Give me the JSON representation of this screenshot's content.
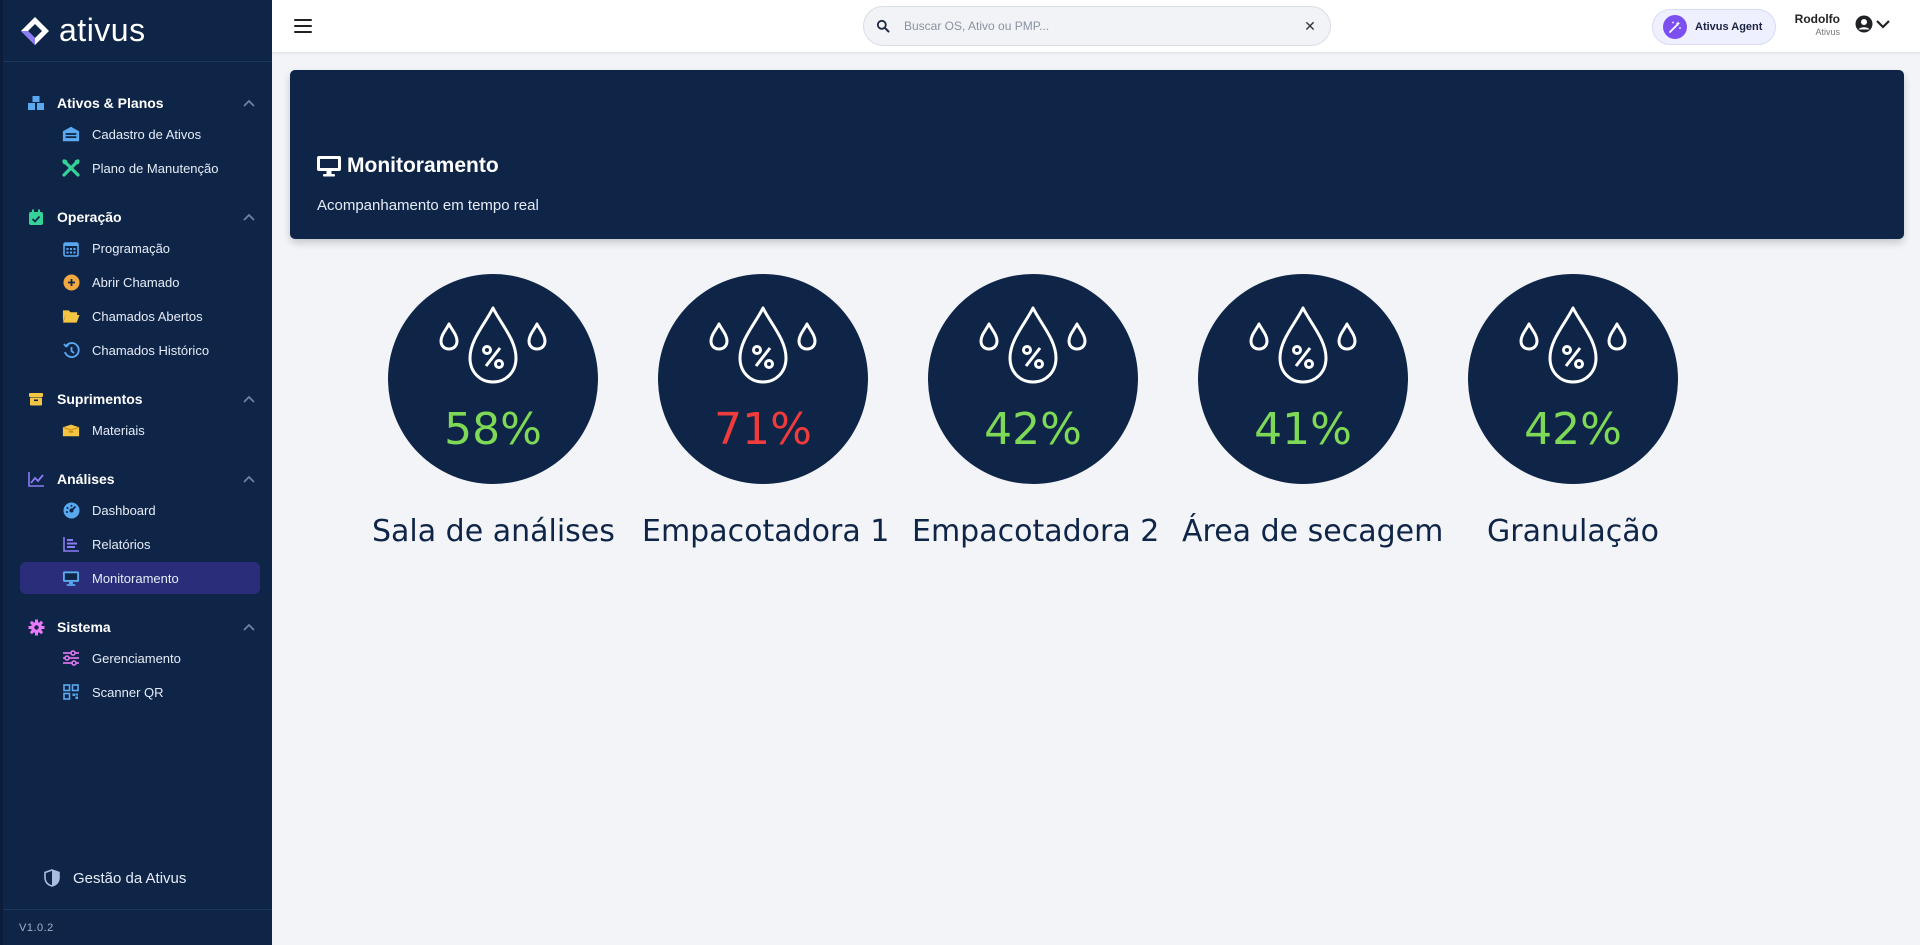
{
  "app": {
    "name": "ativus",
    "version": "V1.0.2"
  },
  "sidebar": {
    "sections": [
      {
        "title": "Ativos & Planos",
        "icon": "boxes-icon",
        "icon_color": "#5aa9f0",
        "items": [
          {
            "label": "Cadastro de Ativos",
            "icon": "warehouse-icon",
            "icon_color": "#5aa9f0"
          },
          {
            "label": "Plano de Manutenção",
            "icon": "tools-icon",
            "icon_color": "#36d399"
          }
        ]
      },
      {
        "title": "Operação",
        "icon": "calendar-check-icon",
        "icon_color": "#36d399",
        "items": [
          {
            "label": "Programação",
            "icon": "calendar-icon",
            "icon_color": "#5aa9f0"
          },
          {
            "label": "Abrir Chamado",
            "icon": "plus-circle-icon",
            "icon_color": "#f4a940"
          },
          {
            "label": "Chamados Abertos",
            "icon": "folder-open-icon",
            "icon_color": "#f4c542"
          },
          {
            "label": "Chamados Histórico",
            "icon": "history-icon",
            "icon_color": "#5aa9f0"
          }
        ]
      },
      {
        "title": "Suprimentos",
        "icon": "box-icon",
        "icon_color": "#f4c542",
        "items": [
          {
            "label": "Materiais",
            "icon": "boxes-open-icon",
            "icon_color": "#f4c542"
          }
        ]
      },
      {
        "title": "Análises",
        "icon": "line-chart-icon",
        "icon_color": "#8b7cf6",
        "items": [
          {
            "label": "Dashboard",
            "icon": "gauge-icon",
            "icon_color": "#5aa9f0"
          },
          {
            "label": "Relatórios",
            "icon": "bar-chart-icon",
            "icon_color": "#8b7cf6"
          },
          {
            "label": "Monitoramento",
            "icon": "monitor-icon",
            "icon_color": "#5aa9f0",
            "active": true
          }
        ]
      },
      {
        "title": "Sistema",
        "icon": "gear-icon",
        "icon_color": "#e879f9",
        "items": [
          {
            "label": "Gerenciamento",
            "icon": "sliders-icon",
            "icon_color": "#e879f9"
          },
          {
            "label": "Scanner QR",
            "icon": "qrcode-icon",
            "icon_color": "#5aa9f0"
          }
        ]
      }
    ],
    "footer_label": "Gestão da Ativus"
  },
  "header": {
    "search_placeholder": "Buscar OS, Ativo ou PMP...",
    "search_value": "",
    "agent_label": "Ativus Agent",
    "user_name": "Rodolfo",
    "user_org": "Ativus"
  },
  "banner": {
    "title": "Monitoramento",
    "subtitle": "Acompanhamento em tempo real"
  },
  "gauges": [
    {
      "name": "Sala de análises",
      "value": "58%",
      "status_color": "#7ed957"
    },
    {
      "name": "Empacotadora 1",
      "value": "71%",
      "status_color": "#ef3b3b"
    },
    {
      "name": "Empacotadora 2",
      "value": "42%",
      "status_color": "#7ed957"
    },
    {
      "name": "Área de secagem",
      "value": "41%",
      "status_color": "#7ed957"
    },
    {
      "name": "Granulação",
      "value": "42%",
      "status_color": "#7ed957"
    }
  ],
  "colors": {
    "sidebar_bg": "#0f2548",
    "page_bg": "#f2f4f8",
    "active_item_bg": "#2a2e7a",
    "ok": "#7ed957",
    "alert": "#ef3b3b",
    "agent_accent": "#7b4ff0"
  }
}
